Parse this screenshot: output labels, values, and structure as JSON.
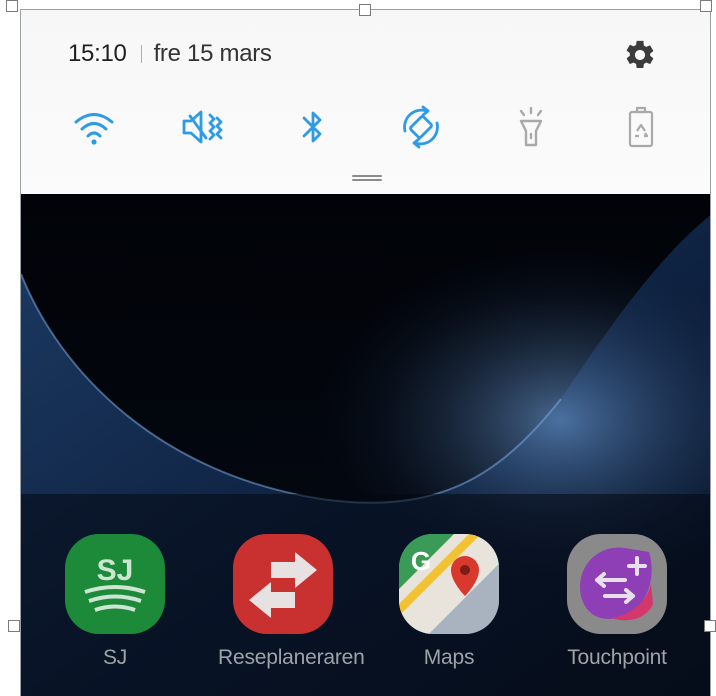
{
  "status": {
    "time": "15:10",
    "date": "fre 15 mars"
  },
  "quick_settings": [
    {
      "name": "wifi",
      "icon": "wifi-icon",
      "active": true
    },
    {
      "name": "sound",
      "icon": "vibrate-mute-icon",
      "active": true
    },
    {
      "name": "bluetooth",
      "icon": "bluetooth-icon",
      "active": true
    },
    {
      "name": "auto-rotate",
      "icon": "auto-rotate-icon",
      "active": true
    },
    {
      "name": "flashlight",
      "icon": "flashlight-icon",
      "active": false
    },
    {
      "name": "power-saving",
      "icon": "battery-recycle-icon",
      "active": false
    }
  ],
  "colors": {
    "active_icon": "#2e9be6",
    "inactive_icon": "#a9a9a9",
    "panel_bg": "#f7f7f7",
    "wallpaper": "#02060d",
    "label": "#9ea3a8"
  },
  "apps": [
    {
      "label": "SJ",
      "icon": "sj-app-icon",
      "color": "#1d8a3a"
    },
    {
      "label": "Reseplaneraren",
      "icon": "reseplaneraren-app-icon",
      "color": "#c8312f"
    },
    {
      "label": "Maps",
      "icon": "maps-app-icon",
      "color": "#3a9b57"
    },
    {
      "label": "Touchpoint",
      "icon": "touchpoint-app-icon",
      "color": "#8e3fb5"
    }
  ]
}
